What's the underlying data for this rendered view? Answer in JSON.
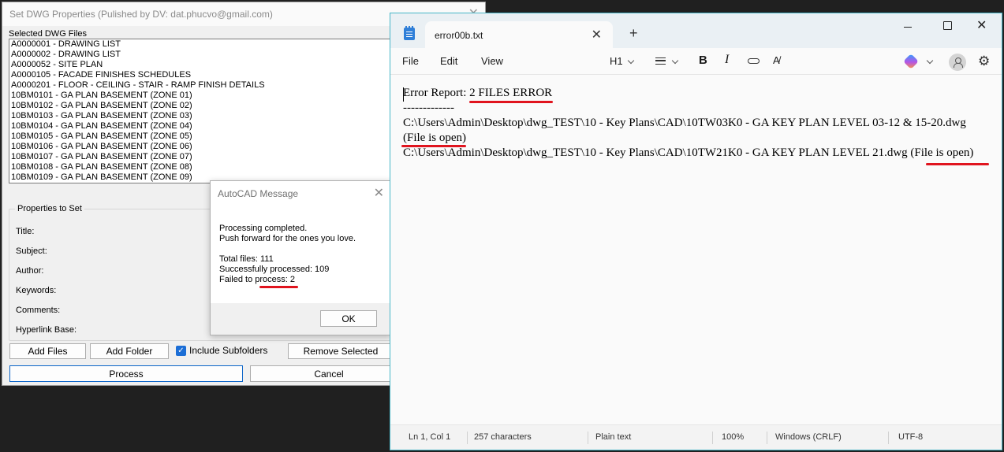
{
  "dwg_window": {
    "title": "Set DWG Properties (Pulished by DV: dat.phucvo@gmail.com)",
    "files_label": "Selected DWG Files",
    "files": [
      "A0000001 - DRAWING LIST",
      "A0000002 - DRAWING LIST",
      "A0000052 - SITE PLAN",
      "A0000105 - FACADE FINISHES SCHEDULES",
      "A0000201 - FLOOR - CEILING - STAIR - RAMP FINISH DETAILS",
      "10BM0101 - GA PLAN BASEMENT (ZONE 01)",
      "10BM0102 - GA PLAN BASEMENT (ZONE 02)",
      "10BM0103 - GA PLAN BASEMENT (ZONE 03)",
      "10BM0104 - GA PLAN BASEMENT (ZONE 04)",
      "10BM0105 - GA PLAN BASEMENT (ZONE 05)",
      "10BM0106 - GA PLAN BASEMENT (ZONE 06)",
      "10BM0107 - GA PLAN BASEMENT (ZONE 07)",
      "10BM0108 - GA PLAN BASEMENT (ZONE 08)",
      "10BM0109 - GA PLAN BASEMENT (ZONE 09)"
    ],
    "properties_label": "Properties to Set",
    "properties": [
      "Title:",
      "Subject:",
      "Author:",
      "Keywords:",
      "Comments:",
      "Hyperlink Base:"
    ],
    "add_files": "Add Files",
    "add_folder": "Add Folder",
    "include_subfolders": "Include Subfolders",
    "include_subfolders_checked": true,
    "remove_selected": "Remove Selected",
    "process": "Process",
    "cancel": "Cancel"
  },
  "acad_message": {
    "title": "AutoCAD Message",
    "line1": "Processing completed.",
    "line2": "Push forward for the ones you love.",
    "total": "Total files: 111",
    "success": "Successfully processed: 109",
    "failed": "Failed to process: 2",
    "ok": "OK"
  },
  "notepad": {
    "tab_title": "error00b.txt",
    "menu": [
      "File",
      "Edit",
      "View"
    ],
    "heading_tool": "H1",
    "lines": [
      "Error Report: 2 FILES ERROR",
      "-------------",
      "C:\\Users\\Admin\\Desktop\\dwg_TEST\\10 - Key Plans\\CAD\\10TW03K0 - GA KEY PLAN LEVEL 03-12 & 15-20.dwg",
      "(File is open)",
      "C:\\Users\\Admin\\Desktop\\dwg_TEST\\10 - Key Plans\\CAD\\10TW21K0 - GA KEY PLAN LEVEL 21.dwg (File is open)"
    ],
    "status": {
      "position": "Ln 1, Col 1",
      "chars": "257 characters",
      "format": "Plain text",
      "zoom": "100%",
      "line_ending": "Windows (CRLF)",
      "encoding": "UTF-8"
    },
    "accent_color": "#2f7fd8",
    "highlight_color": "#e0141e"
  }
}
